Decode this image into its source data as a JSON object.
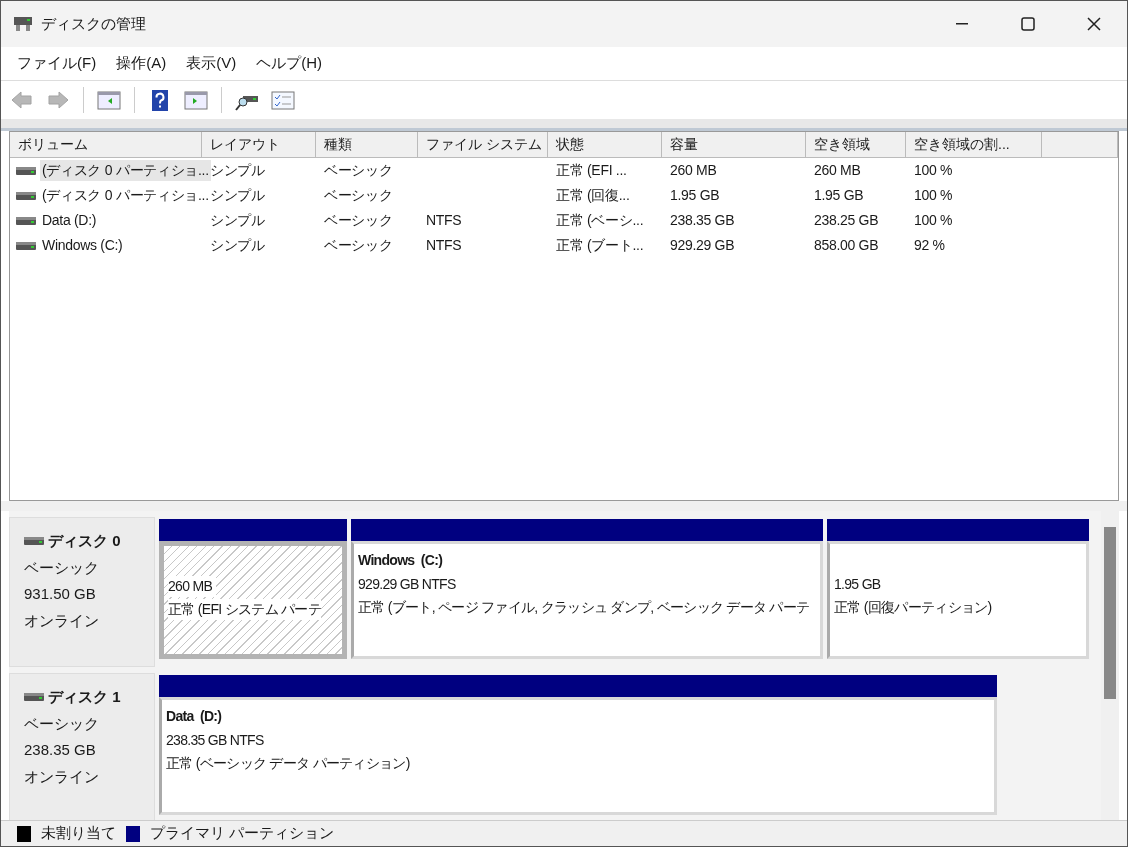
{
  "window": {
    "title": "ディスクの管理"
  },
  "menu": [
    {
      "label": "ファイル(F)"
    },
    {
      "label": "操作(A)"
    },
    {
      "label": "表示(V)"
    },
    {
      "label": "ヘルプ(H)"
    }
  ],
  "toolbar": [
    {
      "kind": "back",
      "disabled": true
    },
    {
      "kind": "forward",
      "disabled": true
    },
    {
      "kind": "sep"
    },
    {
      "kind": "tree",
      "disabled": false
    },
    {
      "kind": "sep"
    },
    {
      "kind": "help",
      "disabled": false
    },
    {
      "kind": "pane",
      "disabled": false
    },
    {
      "kind": "sep"
    },
    {
      "kind": "rescan",
      "disabled": false
    },
    {
      "kind": "list",
      "disabled": false
    }
  ],
  "table": {
    "columns": [
      "ボリューム",
      "レイアウト",
      "種類",
      "ファイル システム",
      "状態",
      "容量",
      "空き領域",
      "空き領域の割..."
    ],
    "rows": [
      {
        "selected": true,
        "cells": [
          "(ディスク 0 パーティショ...",
          "シンプル",
          "ベーシック",
          "",
          "正常 (EFI ...",
          "260 MB",
          "260 MB",
          "100 %"
        ]
      },
      {
        "selected": false,
        "cells": [
          "(ディスク 0 パーティショ...",
          "シンプル",
          "ベーシック",
          "",
          "正常 (回復...",
          "1.95 GB",
          "1.95 GB",
          "100 %"
        ]
      },
      {
        "selected": false,
        "cells": [
          "Data (D:)",
          "シンプル",
          "ベーシック",
          "NTFS",
          "正常 (ベーシ...",
          "238.35 GB",
          "238.25 GB",
          "100 %"
        ]
      },
      {
        "selected": false,
        "cells": [
          "Windows (C:)",
          "シンプル",
          "ベーシック",
          "NTFS",
          "正常 (ブート...",
          "929.29 GB",
          "858.00 GB",
          "92 %"
        ]
      }
    ]
  },
  "disks": [
    {
      "name": "ディスク 0",
      "type": "ベーシック",
      "size": "931.50 GB",
      "state": "オンライン",
      "partitions": [
        {
          "selected": true,
          "size": "260 MB",
          "status": "正常 (EFI システム パーテ"
        },
        {
          "selected": false,
          "label": "Windows  (C:)",
          "size": "929.29 GB NTFS",
          "status": "正常 (ブート, ページ ファイル, クラッシュ ダンプ, ベーシック データ パーテ"
        },
        {
          "selected": false,
          "size": "1.95 GB",
          "status": "正常 (回復パーティション)"
        }
      ]
    },
    {
      "name": "ディスク 1",
      "type": "ベーシック",
      "size": "238.35 GB",
      "state": "オンライン",
      "partitions": [
        {
          "selected": false,
          "label": "Data  (D:)",
          "size": "238.35 GB NTFS",
          "status": "正常 (ベーシック データ パーティション)"
        }
      ]
    }
  ],
  "legend": [
    {
      "label": "未割り当て",
      "color": "#000000"
    },
    {
      "label": "プライマリ パーティション",
      "color": "#000080"
    }
  ]
}
